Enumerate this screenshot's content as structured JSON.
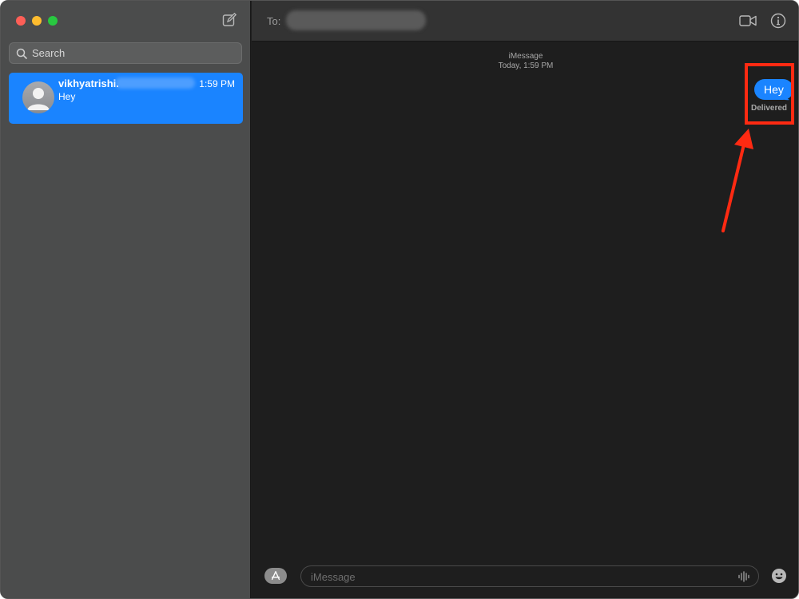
{
  "sidebar": {
    "search": {
      "placeholder": "Search"
    },
    "conversations": [
      {
        "name": "vikhyatrishi.",
        "time": "1:59 PM",
        "preview": "Hey"
      }
    ]
  },
  "header": {
    "to_label": "To:"
  },
  "thread": {
    "service": "iMessage",
    "timestamp": "Today, 1:59 PM",
    "messages": [
      {
        "text": "Hey",
        "direction": "outgoing",
        "status": "Delivered"
      }
    ]
  },
  "composer": {
    "placeholder": "iMessage"
  },
  "colors": {
    "accent": "#1a84ff",
    "annotation": "#ff2a12"
  },
  "icons": [
    "compose-icon",
    "search-icon",
    "video-icon",
    "info-icon",
    "app-store-icon",
    "audio-icon",
    "emoji-icon"
  ]
}
